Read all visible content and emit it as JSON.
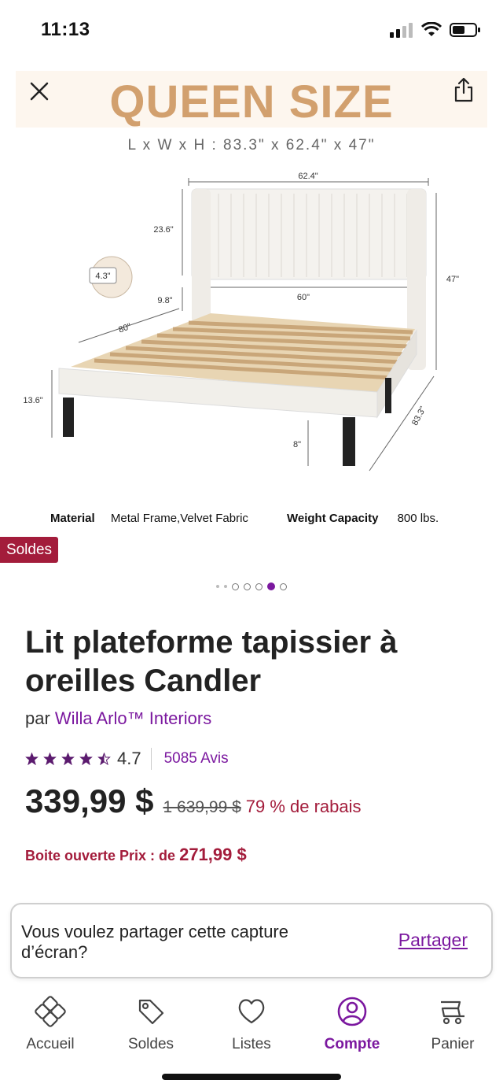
{
  "status_bar": {
    "time": "11:13",
    "icons": [
      "cellular-signal-icon",
      "wifi-icon",
      "battery-icon"
    ]
  },
  "hero": {
    "close_icon": "close-icon",
    "share_icon": "share-icon",
    "banner_title": "QUEEN SIZE",
    "dimensions": "L x W x H :  83.3\" x 62.4\" x 47\"",
    "diagram_labels": {
      "width_top": "62.4\"",
      "headboard_height": "23.6\"",
      "detail": "4.3\"",
      "side_gap": "9.8\"",
      "inner_width": "60\"",
      "total_height": "47\"",
      "length": "80\"",
      "frame_height": "13.6\"",
      "leg_height": "8\"",
      "depth": "83.3\""
    },
    "specs": {
      "material_label": "Material",
      "material_value": "Metal Frame,Velvet Fabric",
      "weight_label": "Weight Capacity",
      "weight_value": "800 lbs."
    },
    "sale_badge": "Soldes",
    "carousel": {
      "count": 7,
      "active_index": 5
    }
  },
  "product": {
    "title": "Lit plateforme tapissier à oreilles Candler",
    "by_prefix": "par",
    "brand": "Willa Arlo™ Interiors",
    "rating": "4.7",
    "rating_value": 4.7,
    "reviews": "5085 Avis",
    "price": "339,99 $",
    "old_price": "1 639,99 $",
    "discount": "79 % de rabais",
    "open_box_label": "Boite ouverte Prix : de",
    "open_box_price": "271,99 $"
  },
  "share_prompt": {
    "text": "Vous voulez partager cette capture d’écran?",
    "action": "Partager"
  },
  "tabs": [
    {
      "label": "Accueil",
      "icon": "home-icon",
      "active": false
    },
    {
      "label": "Soldes",
      "icon": "tag-icon",
      "active": false
    },
    {
      "label": "Listes",
      "icon": "heart-icon",
      "active": false
    },
    {
      "label": "Compte",
      "icon": "account-icon",
      "active": true
    },
    {
      "label": "Panier",
      "icon": "cart-icon",
      "active": false
    }
  ],
  "colors": {
    "brand_purple": "#7b189f",
    "sale_red": "#a31c3b",
    "banner_tan": "#d2a06e"
  }
}
